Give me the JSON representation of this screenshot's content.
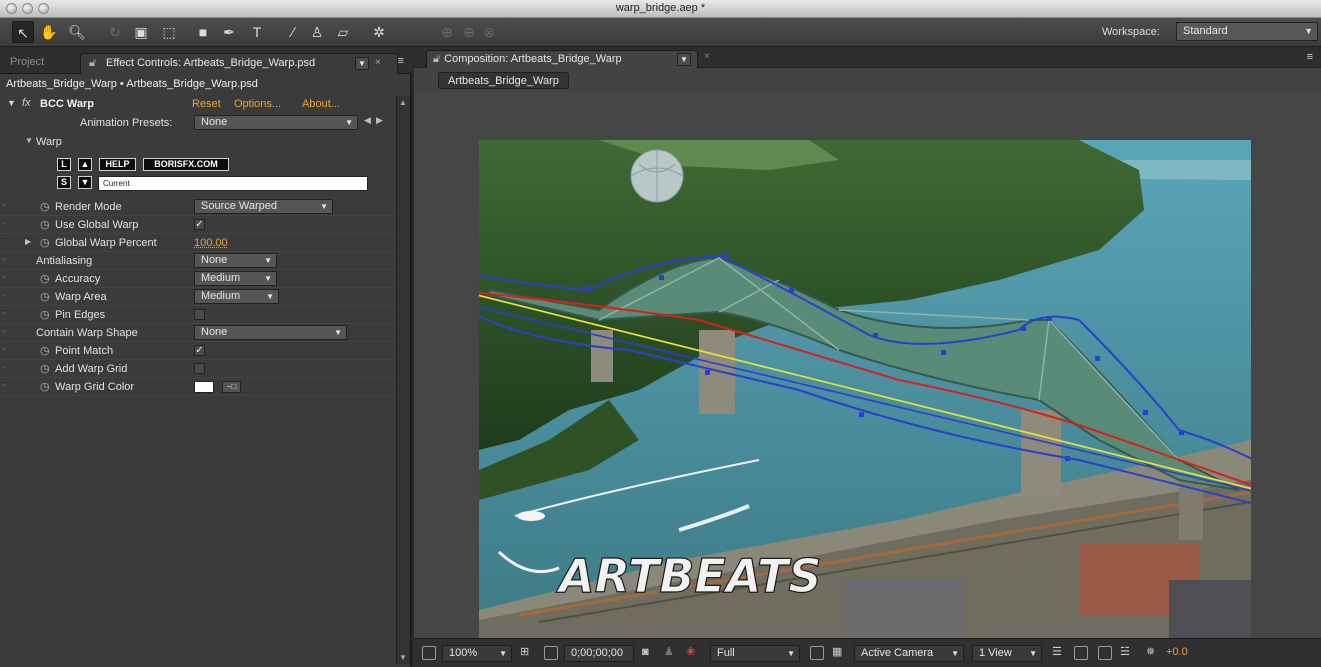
{
  "window": {
    "title": "warp_bridge.aep *"
  },
  "toolbar": {
    "tools": [
      "selection-tool",
      "hand-tool",
      "zoom-tool",
      "rotation-tool",
      "camera-orbit-tool",
      "pan-behind-tool",
      "rectangle-tool",
      "pen-tool",
      "type-tool",
      "brush-tool",
      "clone-stamp-tool",
      "eraser-tool",
      "puppet-tool"
    ],
    "workspace_label": "Workspace:",
    "workspace_value": "Standard"
  },
  "left_panel": {
    "tab_project": "Project",
    "tab_effect_controls": "Effect Controls: Artbeats_Bridge_Warp.psd",
    "breadcrumb": "Artbeats_Bridge_Warp • Artbeats_Bridge_Warp.psd",
    "effect": {
      "fx": "fx",
      "name": "BCC Warp",
      "reset": "Reset",
      "options": "Options...",
      "about": "About..."
    },
    "animation_presets_label": "Animation Presets:",
    "animation_presets_value": "None",
    "warp_group": "Warp",
    "preset_buttons": {
      "l": "L",
      "s": "S",
      "help": "HELP",
      "site": "BORISFX.COM",
      "current": "Current"
    },
    "params": {
      "render_mode": {
        "label": "Render Mode",
        "value": "Source Warped"
      },
      "use_global_warp": {
        "label": "Use Global Warp",
        "checked": true
      },
      "global_warp_percent": {
        "label": "Global Warp Percent",
        "value": "100.00"
      },
      "antialiasing": {
        "label": "Antialiasing",
        "value": "None"
      },
      "accuracy": {
        "label": "Accuracy",
        "value": "Medium"
      },
      "warp_area": {
        "label": "Warp Area",
        "value": "Medium"
      },
      "pin_edges": {
        "label": "Pin Edges",
        "checked": false
      },
      "contain_warp_shape": {
        "label": "Contain Warp Shape",
        "value": "None"
      },
      "point_match": {
        "label": "Point Match",
        "checked": true
      },
      "add_warp_grid": {
        "label": "Add Warp Grid",
        "checked": false
      },
      "warp_grid_color": {
        "label": "Warp Grid Color",
        "color": "#ffffff"
      }
    }
  },
  "composition": {
    "tab": "Composition: Artbeats_Bridge_Warp",
    "flow_button": "Artbeats_Bridge_Warp",
    "watermark": "ARTBEATS",
    "bottom": {
      "zoom": "100%",
      "timecode": "0;00;00;00",
      "resolution": "Full",
      "camera": "Active Camera",
      "views": "1 View",
      "exposure": "+0.0"
    }
  },
  "colors": {
    "accent_orange": "#e8a33a",
    "warp_blue": "#2a3fd0",
    "warp_red": "#d8201c",
    "warp_yellow": "#e8e33a"
  }
}
